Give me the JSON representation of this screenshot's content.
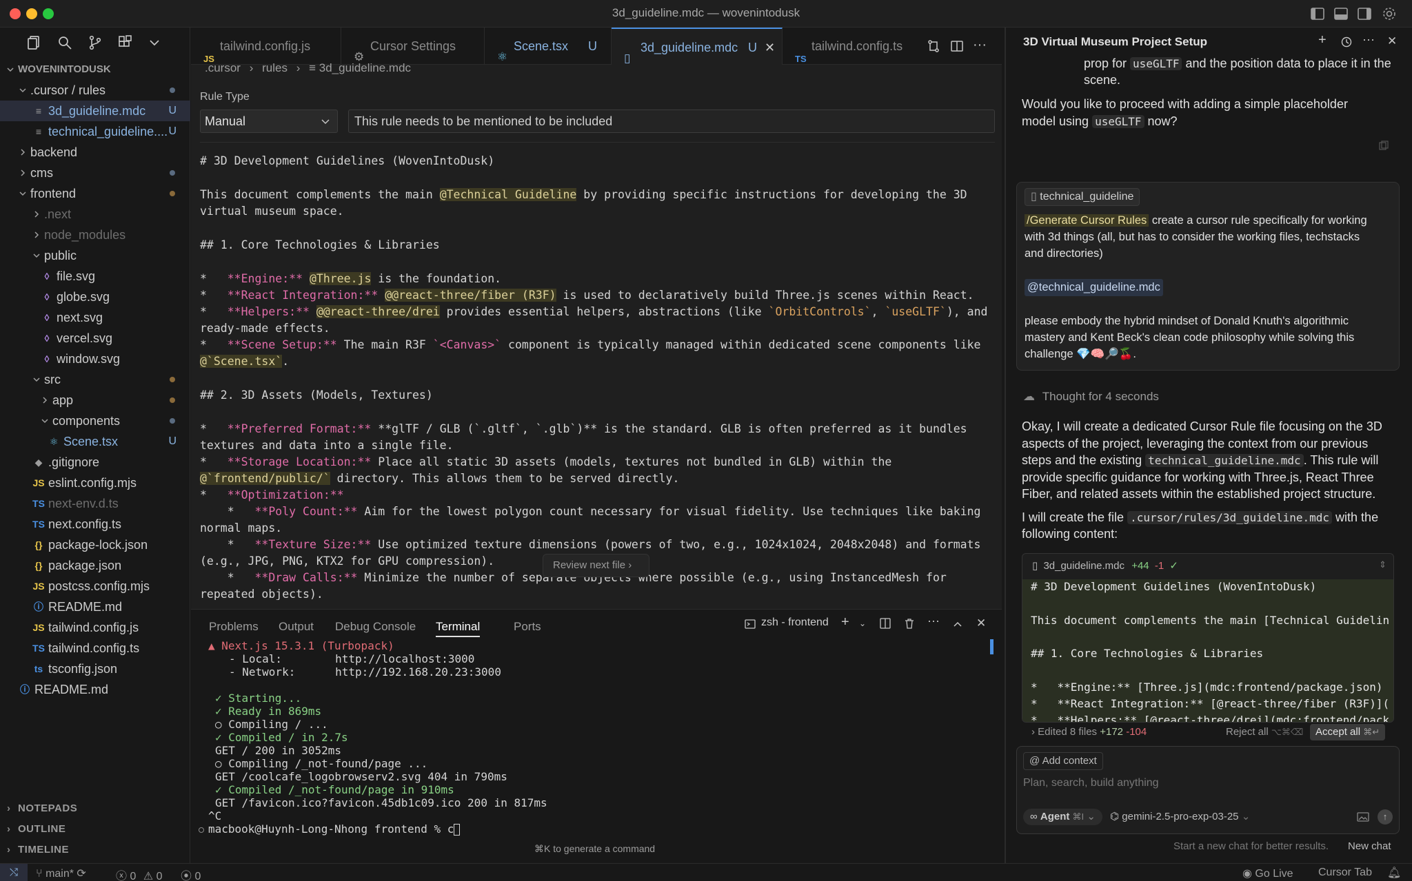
{
  "window": {
    "title": "3d_guideline.mdc — wovenintodusk"
  },
  "explorer": {
    "root": "WOVENINTODUSK",
    "items": [
      {
        "label": ".cursor / rules",
        "depth": 1,
        "chevron": "down"
      },
      {
        "label": "3d_guideline.mdc",
        "depth": 2,
        "badge": "U",
        "icon": "≡"
      },
      {
        "label": "technical_guideline....",
        "depth": 2,
        "badge": "U",
        "icon": "≡"
      },
      {
        "label": "backend",
        "depth": 1,
        "chevron": "right"
      },
      {
        "label": "cms",
        "depth": 1,
        "chevron": "right"
      },
      {
        "label": "frontend",
        "depth": 1,
        "chevron": "down"
      },
      {
        "label": ".next",
        "depth": 2,
        "chevron": "right"
      },
      {
        "label": "node_modules",
        "depth": 2,
        "chevron": "right"
      },
      {
        "label": "public",
        "depth": 2,
        "chevron": "down"
      },
      {
        "label": "file.svg",
        "depth": 3,
        "icon": "◊"
      },
      {
        "label": "globe.svg",
        "depth": 3,
        "icon": "◊"
      },
      {
        "label": "next.svg",
        "depth": 3,
        "icon": "◊"
      },
      {
        "label": "vercel.svg",
        "depth": 3,
        "icon": "◊"
      },
      {
        "label": "window.svg",
        "depth": 3,
        "icon": "◊"
      },
      {
        "label": "src",
        "depth": 2,
        "chevron": "down"
      },
      {
        "label": "app",
        "depth": 3,
        "chevron": "right"
      },
      {
        "label": "components",
        "depth": 3,
        "chevron": "down"
      },
      {
        "label": "Scene.tsx",
        "depth": 4,
        "badge": "U",
        "icon": "⚛"
      },
      {
        "label": ".gitignore",
        "depth": 2,
        "icon": "◆"
      },
      {
        "label": "eslint.config.mjs",
        "depth": 2,
        "icon": "JS"
      },
      {
        "label": "next-env.d.ts",
        "depth": 2,
        "icon": "TS"
      },
      {
        "label": "next.config.ts",
        "depth": 2,
        "icon": "TS"
      },
      {
        "label": "package-lock.json",
        "depth": 2,
        "icon": "{}"
      },
      {
        "label": "package.json",
        "depth": 2,
        "icon": "{}"
      },
      {
        "label": "postcss.config.mjs",
        "depth": 2,
        "icon": "JS"
      },
      {
        "label": "README.md",
        "depth": 2,
        "icon": "ⓘ"
      },
      {
        "label": "tailwind.config.js",
        "depth": 2,
        "icon": "JS"
      },
      {
        "label": "tailwind.config.ts",
        "depth": 2,
        "icon": "TS"
      },
      {
        "label": "tsconfig.json",
        "depth": 2,
        "icon": "ts"
      },
      {
        "label": "README.md",
        "depth": 1,
        "icon": "ⓘ"
      }
    ],
    "sections": [
      "NOTEPADS",
      "OUTLINE",
      "TIMELINE"
    ]
  },
  "tabs": [
    {
      "label": "tailwind.config.js",
      "icon": "JS"
    },
    {
      "label": "Cursor Settings",
      "icon": "⚙"
    },
    {
      "label": "Scene.tsx",
      "icon": "⚛",
      "badge": "U"
    },
    {
      "label": "3d_guideline.mdc",
      "icon": "▯",
      "badge": "U"
    },
    {
      "label": "tailwind.config.ts",
      "icon": "TS"
    }
  ],
  "breadcrumb": [
    ".cursor",
    "rules",
    "3d_guideline.mdc"
  ],
  "rule": {
    "type_label": "Rule Type",
    "type_value": "Manual",
    "description": "This rule needs to be mentioned to be included"
  },
  "doc": {
    "h1": "# 3D Development Guidelines (WovenIntoDusk)",
    "p1a": "This document complements the main ",
    "p1link": "@Technical Guideline",
    "p1b": " by providing specific instructions for developing the 3D",
    "p1c": "virtual museum space.",
    "h2a": "## 1. Core Technologies & Libraries",
    "engine_k": "**Engine:**",
    "engine_link": "@Three.js",
    "engine_rest": " is the foundation.",
    "r3f_k": "**React Integration:**",
    "r3f_link": "@@react-three/fiber (R3F)",
    "r3f_rest": " is used to declaratively build Three.js scenes within React.",
    "helpers_k": "**Helpers:**",
    "helpers_link": "@@react-three/drei",
    "helpers_rest1": " provides essential helpers, abstractions (like ",
    "helpers_c1": "`OrbitControls`",
    "helpers_mid": ", ",
    "helpers_c2": "`useGLTF`",
    "helpers_rest2": "), and",
    "helpers_cont": "ready-made effects.",
    "scene_k": "**Scene Setup:**",
    "scene_rest1": " The main R3F ",
    "scene_c": "`<Canvas>`",
    "scene_rest2": " component is typically managed within dedicated scene components like",
    "scene_link": "@`Scene.tsx`",
    "scene_end": ".",
    "h2b": "## 2. 3D Assets (Models, Textures)",
    "pf_k": "**Preferred Format:**",
    "pf_rest": " **glTF / GLB (`.gltf`, `.glb`)** is the standard. GLB is often preferred as it bundles",
    "pf_cont": "textures and data into a single file.",
    "sl_k": "**Storage Location:**",
    "sl_rest": " Place all static 3D assets (models, textures not bundled in GLB) within the",
    "sl_link": "@`frontend/public/`",
    "sl_cont": " directory. This allows them to be served directly.",
    "opt_k": "**Optimization:**",
    "pc_k": "**Poly Count:**",
    "pc_rest": " Aim for the lowest polygon count necessary for visual fidelity. Use techniques like baking",
    "pc_cont": "normal maps.",
    "ts_k": "**Texture Size:**",
    "ts_rest": " Use optimized texture dimensions (powers of two, e.g., 1024x1024, 2048x2048) and formats",
    "ts_cont": "(e.g., JPG, PNG, KTX2 for GPU compression).",
    "dc_k": "**Draw Calls:**",
    "dc_rest": " Minimize the number of separate objects where possible (e.g., using InstancedMesh for",
    "dc_cont": "repeated objects).",
    "review_btn": "Review next file"
  },
  "panel": {
    "tabs": [
      "Problems",
      "Output",
      "Debug Console",
      "Terminal",
      "Ports"
    ],
    "shell": "zsh - frontend",
    "hint": "⌘K to generate a command",
    "lines": [
      "▲ Next.js 15.3.1 (Turbopack)",
      "- Local:        http://localhost:3000",
      "- Network:      http://192.168.20.23:3000",
      "",
      "✓ Starting...",
      "✓ Ready in 869ms",
      "○ Compiling / ...",
      "✓ Compiled / in 2.7s",
      "GET / 200 in 3052ms",
      "○ Compiling /_not-found/page ...",
      "GET /coolcafe_logobrowserv2.svg 404 in 790ms",
      "✓ Compiled /_not-found/page in 910ms",
      "GET /favicon.ico?favicon.45db1c09.ico 200 in 817ms",
      "^C"
    ],
    "prompt": "macbook@Huynh-Long-Nhong frontend % c"
  },
  "chat": {
    "title": "3D Virtual Museum Project Setup",
    "top1": "prop for ",
    "top_code": "useGLTF",
    "top2": " and the position data to place it in the",
    "top3": "scene.",
    "q1": "Would you like to proceed with adding a simple placeholder",
    "q2a": "model using ",
    "q2code": "useGLTF",
    "q2b": " now?",
    "user_chip": "technical_guideline",
    "user_cmd": "/Generate Cursor Rules",
    "user_text1": " create a cursor rule specifically for working",
    "user_text2": "with 3d things (all, but has to consider the working files, techstacks",
    "user_text3": "and directories)",
    "user_mention": "@technical_guideline.mdc",
    "user_p2a": "please embody the hybrid mindset of Donald Knuth's algorithmic",
    "user_p2b": "mastery and Kent Beck's clean code philosophy while solving this",
    "user_p2c": "challenge 💎🧠🔎🍒.",
    "thought": "Thought for 4 seconds",
    "resp1": "Okay, I will create a dedicated Cursor Rule file focusing on the 3D",
    "resp2": "aspects of the project, leveraging the context from our previous",
    "resp3a": "steps and the existing ",
    "resp3code": "technical_guideline.mdc",
    "resp3b": ". This rule will",
    "resp4": "provide specific guidance for working with Three.js, React Three",
    "resp5": "Fiber, and related assets within the established project structure.",
    "resp6a": "I will create the file ",
    "resp6code": ".cursor/rules/3d_guideline.mdc",
    "resp6b": " with the",
    "resp7": "following content:",
    "codeblock_file": "3d_guideline.mdc",
    "codeblock_add": "+44",
    "codeblock_del": "-1",
    "codeblock_lines": [
      "# 3D Development Guidelines (WovenIntoDusk)",
      "",
      "This document complements the main [Technical Guidelin",
      "",
      "## 1. Core Technologies & Libraries",
      "",
      "*   **Engine:** [Three.js](mdc:frontend/package.json)",
      "*   **React Integration:** [@react-three/fiber (R3F)](",
      "*   **Helpers:** [@react-three/drei](mdc:frontend/pack"
    ],
    "edited_label": "Edited 8 files",
    "edited_add": "+172",
    "edited_del": "-104",
    "reject": "Reject all",
    "reject_kbd": "⌥⌘⌫",
    "accept": "Accept all",
    "accept_kbd": "⌘↵",
    "add_context": "Add context",
    "input_placeholder": "Plan, search, build anything",
    "agent": "Agent",
    "agent_kbd": "⌘I",
    "model": "gemini-2.5-pro-exp-03-25",
    "footer_hint": "Start a new chat for better results.",
    "new_chat": "New chat"
  },
  "status": {
    "branch": "main*",
    "errors": "0",
    "warnings": "0",
    "ports": "0",
    "golive": "Go Live",
    "cursortab": "Cursor Tab"
  },
  "colors": {
    "accent": "#4a90e2",
    "bg": "#1f1f1f",
    "added": "#b5cea8",
    "deleted": "#e06c75"
  }
}
